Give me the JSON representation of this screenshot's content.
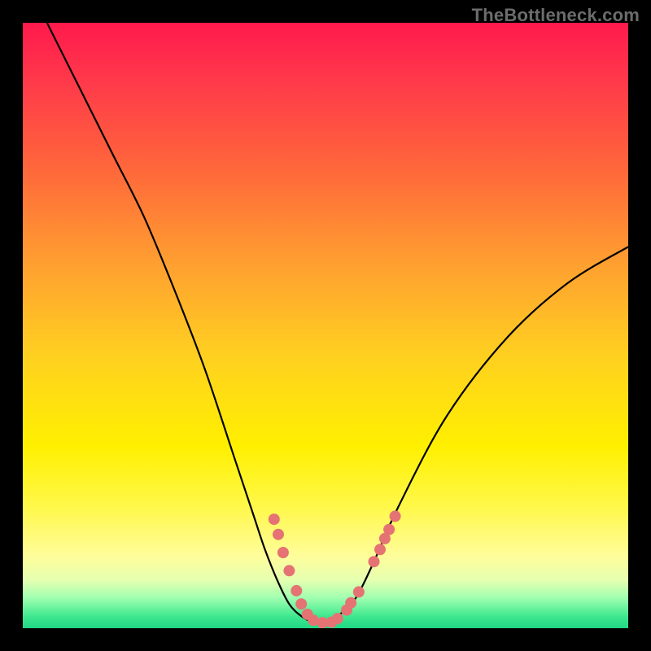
{
  "watermark": "TheBottleneck.com",
  "chart_data": {
    "type": "line",
    "title": "",
    "xlabel": "",
    "ylabel": "",
    "xlim": [
      0,
      100
    ],
    "ylim": [
      0,
      100
    ],
    "series": [
      {
        "name": "curve",
        "x": [
          4,
          10,
          15,
          20,
          25,
          30,
          35,
          38,
          40,
          42,
          44,
          46,
          48,
          50,
          52,
          55,
          58,
          62,
          70,
          80,
          90,
          100
        ],
        "y": [
          100,
          88,
          78,
          68,
          56,
          43,
          28,
          19,
          13,
          8,
          4,
          2,
          1,
          1,
          2,
          5,
          11,
          20,
          35,
          48,
          57,
          63
        ]
      }
    ],
    "markers": [
      {
        "x": 41.5,
        "y": 18.0
      },
      {
        "x": 42.2,
        "y": 15.5
      },
      {
        "x": 43.0,
        "y": 12.5
      },
      {
        "x": 44.0,
        "y": 9.5
      },
      {
        "x": 45.2,
        "y": 6.2
      },
      {
        "x": 46.0,
        "y": 4.0
      },
      {
        "x": 47.0,
        "y": 2.3
      },
      {
        "x": 48.0,
        "y": 1.3
      },
      {
        "x": 49.5,
        "y": 0.9
      },
      {
        "x": 51.0,
        "y": 1.0
      },
      {
        "x": 52.0,
        "y": 1.6
      },
      {
        "x": 53.5,
        "y": 3.0
      },
      {
        "x": 54.2,
        "y": 4.2
      },
      {
        "x": 55.5,
        "y": 6.0
      },
      {
        "x": 58.0,
        "y": 11.0
      },
      {
        "x": 59.0,
        "y": 13.0
      },
      {
        "x": 59.8,
        "y": 14.8
      },
      {
        "x": 60.5,
        "y": 16.3
      },
      {
        "x": 61.5,
        "y": 18.5
      }
    ],
    "marker_color": "#e57373",
    "curve_color": "#000000"
  }
}
